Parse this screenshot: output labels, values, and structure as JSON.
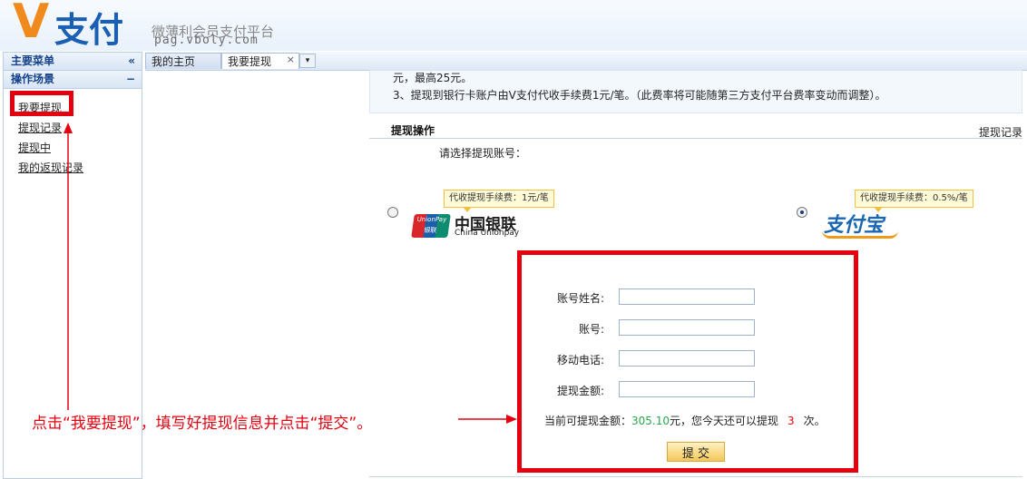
{
  "header": {
    "logo_v": "V",
    "logo_zh": "支付",
    "tagline": "微薄利会员支付平台",
    "url": "pag.vboly.com"
  },
  "sidebar": {
    "main_menu": "主要菜单",
    "main_menu_ctrl": "«",
    "section": "操作场景",
    "section_ctrl": "−",
    "items": [
      {
        "label": "我要提现"
      },
      {
        "label": "提现记录"
      },
      {
        "label": "提现中"
      },
      {
        "label": "我的返现记录"
      }
    ]
  },
  "tabs": {
    "home": "我的主页",
    "current": "我要提现",
    "close": "×",
    "menu": "▾"
  },
  "notice": {
    "line1": "元，最高25元。",
    "line2": "3、提现到银行卡账户由V支付代收手续费1元/笔。（此费率将可能随第三方支付平台费率变动而调整）。"
  },
  "section": {
    "title": "提现操作",
    "record_link": "提现记录",
    "choose_prompt": "请选择提现账号："
  },
  "methods": {
    "unionpay": {
      "tip": "代收提现手续费：1元/笔",
      "badge_top": "UnionPay",
      "badge_bottom": "银联",
      "name_zh": "中国银联",
      "name_en": "China Unionpay"
    },
    "alipay": {
      "tip": "代收提现手续费：0.5%/笔",
      "name": "支付宝"
    }
  },
  "form": {
    "account_name_label": "账号姓名:",
    "account_label": "账号:",
    "phone_label": "移动电话:",
    "amount_label": "提现金额:",
    "account_name_value": "",
    "account_value": "",
    "phone_value": "",
    "amount_value": "",
    "balance_prefix": "当前可提现金额：",
    "balance_amount": "305.10",
    "balance_mid": "元，您今天还可以提现",
    "balance_count": "3",
    "balance_suffix": "次。",
    "submit_label": "提 交"
  },
  "annotation": {
    "text": "点击“我要提现”，填写好提现信息并点击“提交”。",
    "color": "#e5000f"
  }
}
